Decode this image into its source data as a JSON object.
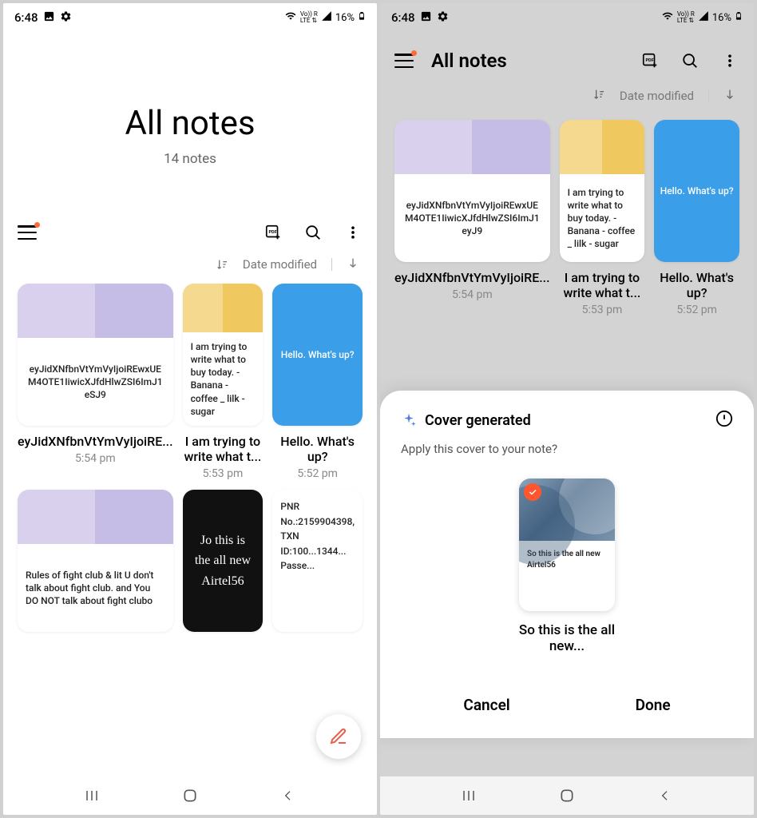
{
  "status": {
    "time": "6:48",
    "battery": "16%",
    "network": "LTE"
  },
  "left": {
    "header_title": "All notes",
    "header_subtitle": "14 notes",
    "sort_label": "Date modified",
    "notes": [
      {
        "thumb_text": "eyJidXNfbnVtYmVyIjoiREwxUEM4OTE1IiwicXJfdHlwZSI6ImJ1eSJ9",
        "title": "eyJidXNfbnVtYmVyIjoiRE...",
        "time": "5:54 pm",
        "colors": [
          "#d8d0ec",
          "#c6bde6"
        ]
      },
      {
        "thumb_text": "I am trying to write what to buy today. - Banana - coffee _ lilk - sugar",
        "title": "I am trying to write what t...",
        "time": "5:53 pm",
        "colors": [
          "#f4d98e",
          "#efc95f"
        ]
      },
      {
        "blue_text": "Hello. What's up?",
        "title": "Hello. What's up?",
        "time": "5:52 pm"
      },
      {
        "thumb_text": "Rules of fight club & lit U don't talk about fight club. and You DO NOT talk about fight clubo",
        "colors": [
          "#d8d0ec",
          "#c6bde6"
        ]
      },
      {
        "dark_text": "Jo this is the all new Airtel56"
      },
      {
        "white_text": "PNR No.:2159904398, TXN ID:100...1344... Passe..."
      }
    ]
  },
  "right": {
    "toolbar_title": "All notes",
    "sort_label": "Date modified",
    "notes": [
      {
        "thumb_text": "eyJidXNfbnVtYmVyIjoiREwxUEM4OTE1IiwicXJfdHlwZSI6ImJ1eyJ9",
        "title": "eyJidXNfbnVtYmVyIjoiRE...",
        "time": "5:54 pm",
        "colors": [
          "#d8d0ec",
          "#c6bde6"
        ]
      },
      {
        "thumb_text": "I am trying to write what to buy today. - Banana - coffee _ lilk - sugar",
        "title": "I am trying to write what t...",
        "time": "5:53 pm",
        "colors": [
          "#f4d98e",
          "#efc95f"
        ]
      },
      {
        "blue_text": "Hello. What's up?",
        "title": "Hello. What's up?",
        "time": "5:52 pm"
      }
    ],
    "sheet": {
      "title": "Cover generated",
      "subtitle": "Apply this cover to your note?",
      "preview_text": "So this is the all new Airtel56",
      "preview_title": "So this is the all new...",
      "cancel": "Cancel",
      "done": "Done"
    }
  }
}
